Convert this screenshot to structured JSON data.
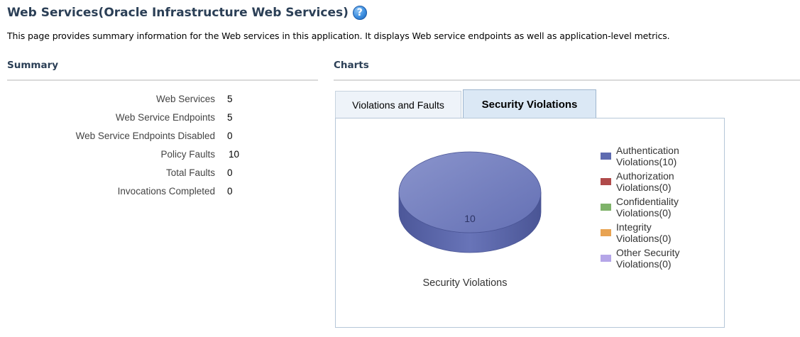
{
  "header": {
    "title": "Web Services(Oracle Infrastructure Web Services)",
    "help_icon": "help-question-icon",
    "description": "This page provides summary information for the Web services in this application. It displays Web service endpoints as well as application-level metrics."
  },
  "summary": {
    "heading": "Summary",
    "rows": [
      {
        "label": "Web Services",
        "value": "5"
      },
      {
        "label": "Web Service Endpoints",
        "value": "5"
      },
      {
        "label": "Web Service Endpoints Disabled",
        "value": "0"
      },
      {
        "label": "Policy Faults",
        "value": "10"
      },
      {
        "label": "Total Faults",
        "value": "0"
      },
      {
        "label": "Invocations Completed",
        "value": "0"
      }
    ]
  },
  "charts": {
    "heading": "Charts",
    "tabs": [
      {
        "label": "Violations and Faults",
        "selected": false
      },
      {
        "label": "Security Violations",
        "selected": true
      }
    ]
  },
  "chart_data": {
    "type": "pie",
    "title": "Security Violations",
    "categories": [
      "Authentication Violations",
      "Authorization Violations",
      "Confidentiality Violations",
      "Integrity Violations",
      "Other Security Violations"
    ],
    "values": [
      10,
      0,
      0,
      0,
      0
    ],
    "colors": [
      "#5e6bb0",
      "#b04a4a",
      "#7fb36a",
      "#e8a352",
      "#b5a6e8"
    ],
    "slice_labels": [
      "10"
    ],
    "legend": [
      {
        "line1": "Authentication",
        "line2": "Violations(10)"
      },
      {
        "line1": "Authorization",
        "line2": "Violations(0)"
      },
      {
        "line1": "Confidentiality",
        "line2": "Violations(0)"
      },
      {
        "line1": "Integrity",
        "line2": "Violations(0)"
      },
      {
        "line1": "Other Security",
        "line2": "Violations(0)"
      }
    ],
    "legend_position": "right",
    "style": "3d"
  }
}
